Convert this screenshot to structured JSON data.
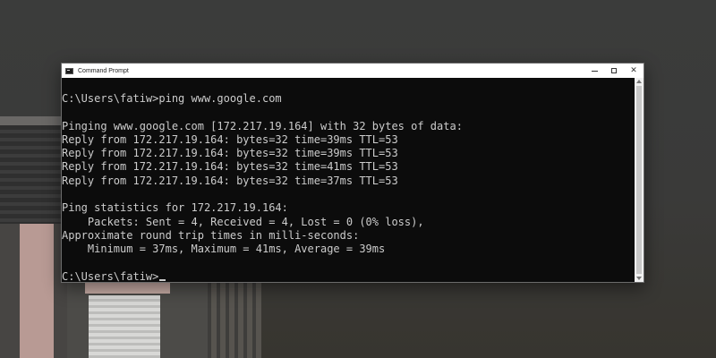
{
  "window": {
    "title": "Command Prompt",
    "controls": {
      "minimize": "",
      "maximize": "",
      "close": "✕"
    }
  },
  "console": {
    "lines": [
      "C:\\Users\\fatiw>ping www.google.com",
      "",
      "Pinging www.google.com [172.217.19.164] with 32 bytes of data:",
      "Reply from 172.217.19.164: bytes=32 time=39ms TTL=53",
      "Reply from 172.217.19.164: bytes=32 time=39ms TTL=53",
      "Reply from 172.217.19.164: bytes=32 time=41ms TTL=53",
      "Reply from 172.217.19.164: bytes=32 time=37ms TTL=53",
      "",
      "Ping statistics for 172.217.19.164:",
      "    Packets: Sent = 4, Received = 4, Lost = 0 (0% loss),",
      "Approximate round trip times in milli-seconds:",
      "    Minimum = 37ms, Maximum = 41ms, Average = 39ms",
      ""
    ],
    "prompt": "C:\\Users\\fatiw>"
  },
  "colors": {
    "console_bg": "#0c0c0c",
    "console_text": "#cccccc",
    "titlebar_bg": "#ffffff"
  },
  "icons": {
    "app": "command-prompt-icon",
    "minimize": "minimize-icon",
    "maximize": "maximize-icon",
    "close": "close-icon"
  }
}
